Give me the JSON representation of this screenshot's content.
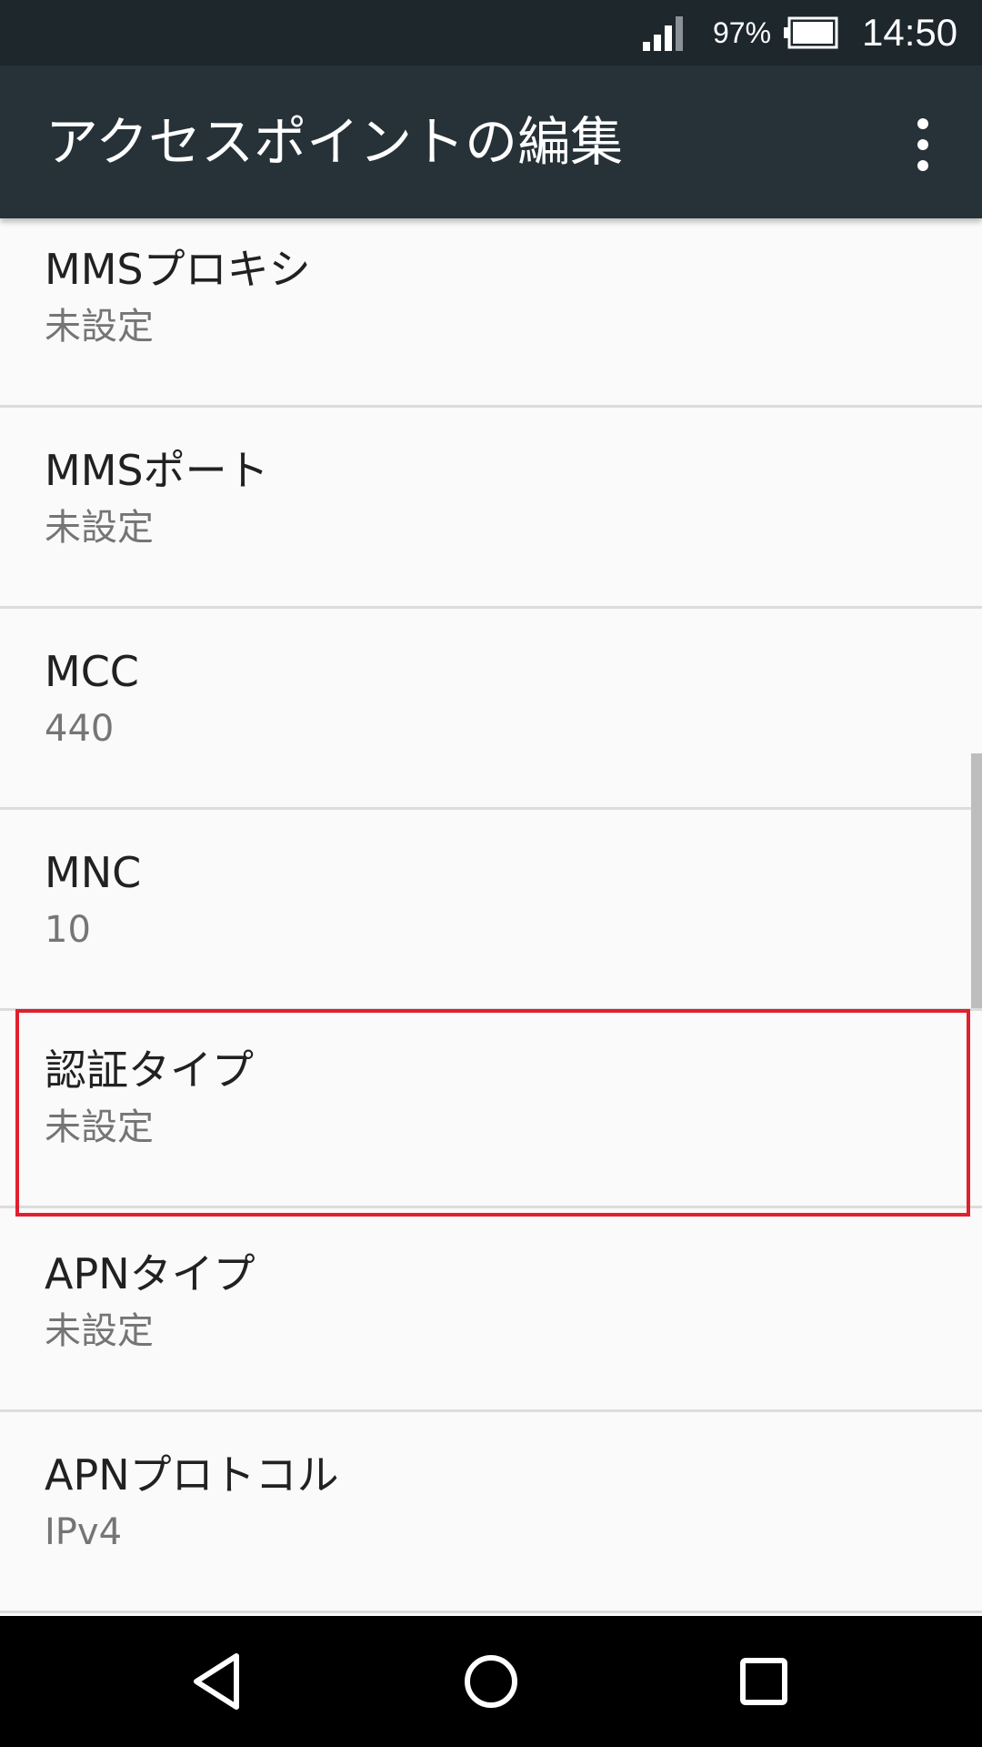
{
  "status_bar": {
    "battery_percent": "97%",
    "time": "14:50"
  },
  "app_bar": {
    "title": "アクセスポイントの編集"
  },
  "settings": [
    {
      "label": "MMSプロキシ",
      "value": "未設定"
    },
    {
      "label": "MMSポート",
      "value": "未設定"
    },
    {
      "label": "MCC",
      "value": "440"
    },
    {
      "label": "MNC",
      "value": "10"
    },
    {
      "label": "認証タイプ",
      "value": "未設定"
    },
    {
      "label": "APNタイプ",
      "value": "未設定"
    },
    {
      "label": "APNプロトコル",
      "value": "IPv4"
    }
  ],
  "highlighted_item": "認証タイプ",
  "colors": {
    "status_bar_bg": "#1d272c",
    "app_bar_bg": "#263238",
    "list_bg": "#fafafa",
    "highlight_border": "#e0202e",
    "nav_bar_bg": "#000000"
  },
  "icons": {
    "signal": "signal-strength-icon",
    "battery": "battery-icon",
    "overflow": "more-vert-icon",
    "back": "back-triangle-icon",
    "home": "home-circle-icon",
    "recents": "recents-square-icon"
  }
}
